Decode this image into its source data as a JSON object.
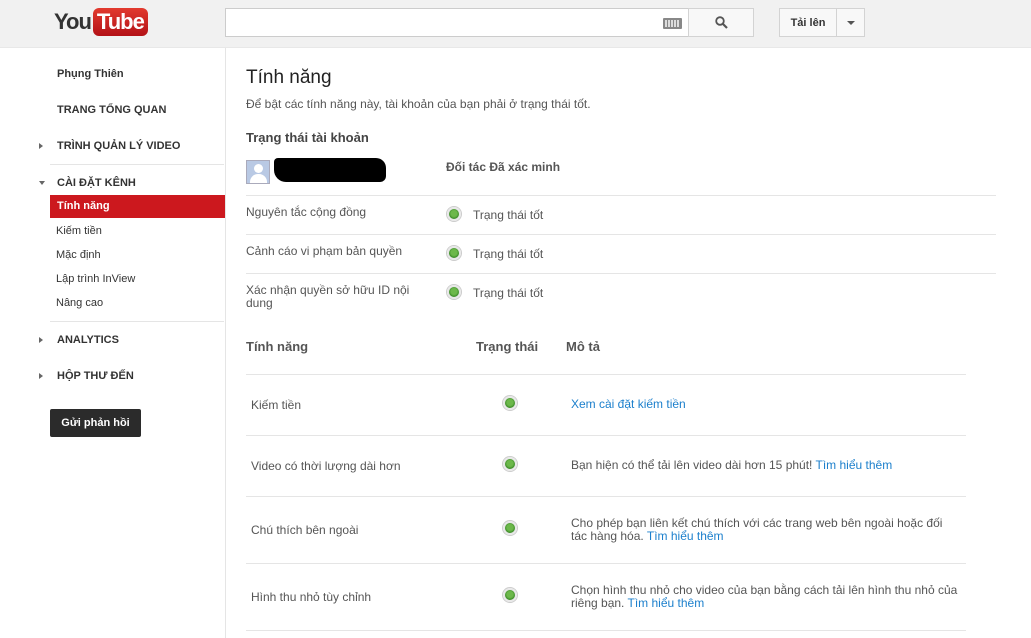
{
  "header": {
    "logo_you": "You",
    "logo_tube": "Tube",
    "search_placeholder": "",
    "upload_label": "Tải lên"
  },
  "sidebar": {
    "user": "Phụng Thiên",
    "dashboard": "TRANG TỔNG QUAN",
    "video_manager": "TRÌNH QUẢN LÝ VIDEO",
    "channel_settings": "CÀI ĐẶT KÊNH",
    "sub_items": [
      "Tính năng",
      "Kiếm tiền",
      "Mặc định",
      "Lập trình InView",
      "Nâng cao"
    ],
    "analytics": "ANALYTICS",
    "inbox": "HỘP THƯ ĐẾN",
    "feedback": "Gửi phản hồi"
  },
  "main": {
    "title": "Tính năng",
    "subtitle": "Để bật các tính năng này, tài khoản của bạn phải ở trạng thái tốt.",
    "account_status_heading": "Trạng thái tài khoản",
    "partner_status": "Đối tác Đã xác minh",
    "status_rows": [
      {
        "label": "Nguyên tắc cộng đồng",
        "status": "Trạng thái tốt"
      },
      {
        "label": "Cảnh cáo vi phạm bản quyền",
        "status": "Trạng thái tốt"
      },
      {
        "label": "Xác nhận quyền sở hữu ID nội dung",
        "status": "Trạng thái tốt"
      }
    ],
    "columns": {
      "feature": "Tính năng",
      "status": "Trạng thái",
      "description": "Mô tả"
    },
    "features": [
      {
        "name": "Kiếm tiền",
        "desc": "",
        "link": "Xem cài đặt kiếm tiền"
      },
      {
        "name": "Video có thời lượng dài hơn",
        "desc": "Bạn hiện có thể tải lên video dài hơn 15 phút!",
        "link": "Tìm hiểu thêm"
      },
      {
        "name": "Chú thích bên ngoài",
        "desc": "Cho phép bạn liên kết chú thích với các trang web bên ngoài hoặc đối tác hàng hóa.",
        "link": "Tìm hiểu thêm"
      },
      {
        "name": "Hình thu nhỏ tùy chỉnh",
        "desc": "Chọn hình thu nhỏ cho video của bạn bằng cách tải lên hình thu nhỏ của riêng bạn.",
        "link": "Tìm hiểu thêm"
      }
    ],
    "status_color": "#3e8e2a",
    "link_color": "#1b7fcc"
  }
}
